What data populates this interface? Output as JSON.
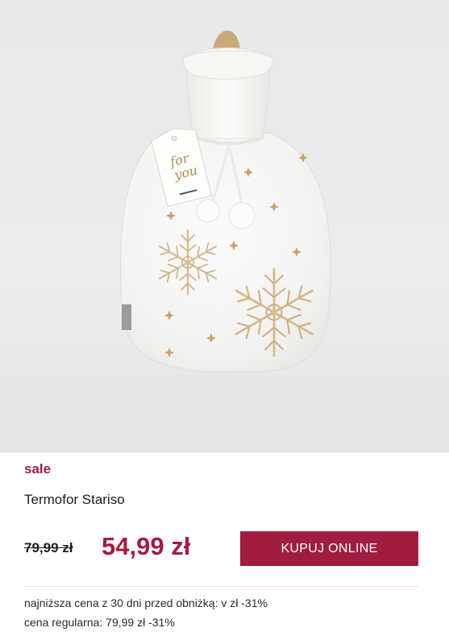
{
  "product": {
    "image_alt": "Termofor Stariso",
    "tag_text": "for you",
    "sale_label": "sale",
    "name": "Termofor Stariso",
    "old_price": "79,99 zł",
    "new_price": "54,99 zł",
    "buy_label": "KUPUJ ONLINE",
    "lowest_price_note": "najniższa cena z 30 dni przed obniżką: v zł -31%",
    "regular_price_note": "cena regularna: 79,99 zł -31%"
  },
  "colors": {
    "accent": "#a01d3f",
    "background": "#ffffff",
    "photo_background": "#ebebec",
    "text": "#1d1d1d"
  }
}
